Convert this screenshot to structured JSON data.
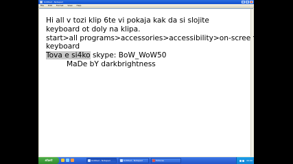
{
  "window": {
    "title": "Untitled - Notepad",
    "menu": [
      "File",
      "Edit",
      "Format",
      "View",
      "Help"
    ]
  },
  "document": {
    "lines": [
      "Hi all v tozi klip 6te vi pokaja kak da si slojite",
      "keyboard ot doly na klipa.",
      "start>all programs>accessories>accessibility>on-screen",
      "keyboard"
    ],
    "line5_selected": "Tova e si4ko",
    "line5_rest": " skype: BoW_WoW50",
    "line6": "MaDe bY  darkbrightness"
  },
  "taskbar": {
    "start_label": "start",
    "tasks": [
      "Untitled - Notepad",
      "Untitled - Notepad",
      "Pictures"
    ],
    "clock": "00:00"
  },
  "colors": {
    "titlebar": "#0f4fcf",
    "taskbar": "#2455c9",
    "start": "#3a9a36",
    "selection": "#c9c9c9"
  }
}
